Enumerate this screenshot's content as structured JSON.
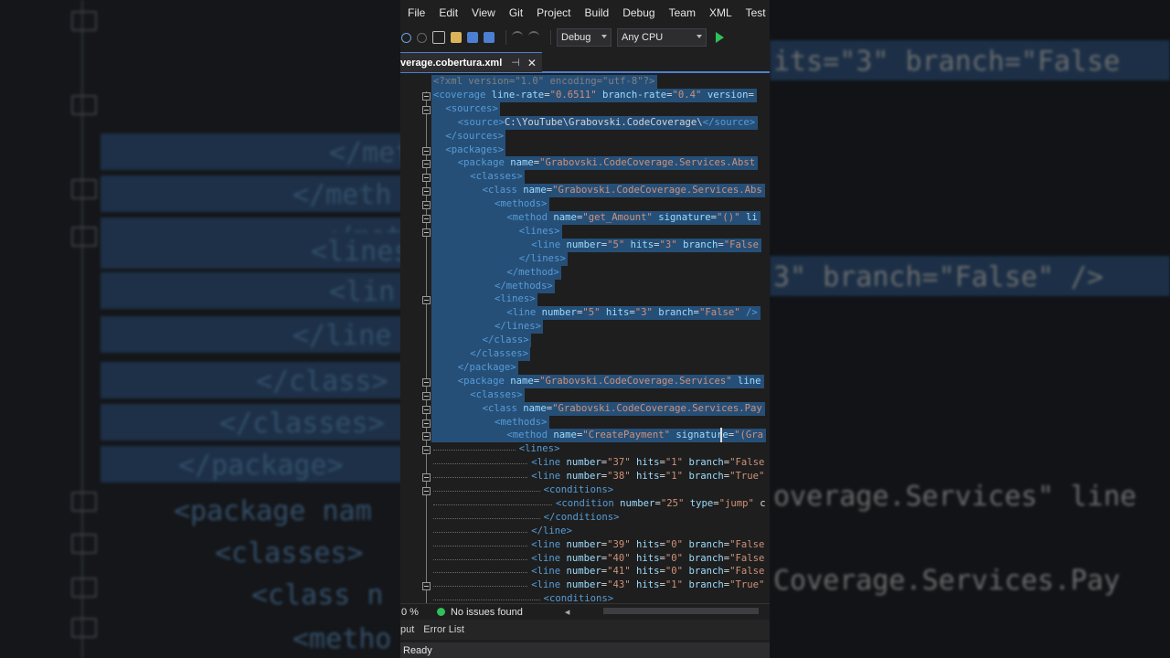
{
  "menu": [
    "File",
    "Edit",
    "View",
    "Git",
    "Project",
    "Build",
    "Debug",
    "Team",
    "XML",
    "Test"
  ],
  "toolbar": {
    "config": "Debug",
    "platform": "Any CPU"
  },
  "tab": {
    "label": "verage.cobertura.xml"
  },
  "code": [
    {
      "indent": 0,
      "tokens": [
        [
          "pi",
          "<?xml version=\"1.0\" encoding=\"utf-8\"?>"
        ]
      ]
    },
    {
      "indent": 0,
      "tokens": [
        [
          "t",
          "<coverage"
        ],
        [
          "an",
          " line-rate"
        ],
        [
          "txt",
          "="
        ],
        [
          "av",
          "\"0.6511\""
        ],
        [
          "an",
          " branch-rate"
        ],
        [
          "txt",
          "="
        ],
        [
          "av",
          "\"0.4\""
        ],
        [
          "an",
          " version"
        ],
        [
          "txt",
          "="
        ]
      ]
    },
    {
      "indent": 1,
      "tokens": [
        [
          "t",
          "<sources>"
        ]
      ]
    },
    {
      "indent": 2,
      "tokens": [
        [
          "t",
          "<source>"
        ],
        [
          "txt",
          "C:\\YouTube\\Grabovski.CodeCoverage\\"
        ],
        [
          "t",
          "</source>"
        ]
      ]
    },
    {
      "indent": 1,
      "tokens": [
        [
          "t",
          "</sources>"
        ]
      ]
    },
    {
      "indent": 1,
      "tokens": [
        [
          "t",
          "<packages>"
        ]
      ]
    },
    {
      "indent": 2,
      "tokens": [
        [
          "t",
          "<package"
        ],
        [
          "an",
          " name"
        ],
        [
          "txt",
          "="
        ],
        [
          "av",
          "\"Grabovski.CodeCoverage.Services.Abst"
        ]
      ]
    },
    {
      "indent": 3,
      "tokens": [
        [
          "t",
          "<classes>"
        ]
      ]
    },
    {
      "indent": 4,
      "tokens": [
        [
          "t",
          "<class"
        ],
        [
          "an",
          " name"
        ],
        [
          "txt",
          "="
        ],
        [
          "av",
          "\"Grabovski.CodeCoverage.Services.Abs"
        ]
      ]
    },
    {
      "indent": 5,
      "tokens": [
        [
          "t",
          "<methods>"
        ]
      ]
    },
    {
      "indent": 6,
      "tokens": [
        [
          "t",
          "<method"
        ],
        [
          "an",
          " name"
        ],
        [
          "txt",
          "="
        ],
        [
          "av",
          "\"get_Amount\""
        ],
        [
          "an",
          " signature"
        ],
        [
          "txt",
          "="
        ],
        [
          "av",
          "\"()\""
        ],
        [
          "an",
          " li"
        ]
      ]
    },
    {
      "indent": 7,
      "tokens": [
        [
          "t",
          "<lines>"
        ]
      ]
    },
    {
      "indent": 8,
      "tokens": [
        [
          "t",
          "<line"
        ],
        [
          "an",
          " number"
        ],
        [
          "txt",
          "="
        ],
        [
          "av",
          "\"5\""
        ],
        [
          "an",
          " hits"
        ],
        [
          "txt",
          "="
        ],
        [
          "av",
          "\"3\""
        ],
        [
          "an",
          " branch"
        ],
        [
          "txt",
          "="
        ],
        [
          "av",
          "\"False"
        ]
      ]
    },
    {
      "indent": 7,
      "tokens": [
        [
          "t",
          "</lines>"
        ]
      ]
    },
    {
      "indent": 6,
      "tokens": [
        [
          "t",
          "</method>"
        ]
      ]
    },
    {
      "indent": 5,
      "tokens": [
        [
          "t",
          "</methods>"
        ]
      ]
    },
    {
      "indent": 5,
      "tokens": [
        [
          "t",
          "<lines>"
        ]
      ]
    },
    {
      "indent": 6,
      "tokens": [
        [
          "t",
          "<line"
        ],
        [
          "an",
          " number"
        ],
        [
          "txt",
          "="
        ],
        [
          "av",
          "\"5\""
        ],
        [
          "an",
          " hits"
        ],
        [
          "txt",
          "="
        ],
        [
          "av",
          "\"3\""
        ],
        [
          "an",
          " branch"
        ],
        [
          "txt",
          "="
        ],
        [
          "av",
          "\"False\""
        ],
        [
          "t",
          " />"
        ]
      ]
    },
    {
      "indent": 5,
      "tokens": [
        [
          "t",
          "</lines>"
        ]
      ]
    },
    {
      "indent": 4,
      "tokens": [
        [
          "t",
          "</class>"
        ]
      ]
    },
    {
      "indent": 3,
      "tokens": [
        [
          "t",
          "</classes>"
        ]
      ]
    },
    {
      "indent": 2,
      "tokens": [
        [
          "t",
          "</package>"
        ]
      ]
    },
    {
      "indent": 2,
      "tokens": [
        [
          "t",
          "<package"
        ],
        [
          "an",
          " name"
        ],
        [
          "txt",
          "="
        ],
        [
          "av",
          "\"Grabovski.CodeCoverage.Services\""
        ],
        [
          "an",
          " line"
        ]
      ]
    },
    {
      "indent": 3,
      "tokens": [
        [
          "t",
          "<classes>"
        ]
      ]
    },
    {
      "indent": 4,
      "tokens": [
        [
          "t",
          "<class"
        ],
        [
          "an",
          " name"
        ],
        [
          "txt",
          "="
        ],
        [
          "av",
          "\"Grabovski.CodeCoverage.Services.Pay"
        ]
      ]
    },
    {
      "indent": 5,
      "tokens": [
        [
          "t",
          "<methods>"
        ]
      ]
    },
    {
      "indent": 6,
      "tokens": [
        [
          "t",
          "<method"
        ],
        [
          "an",
          " name"
        ],
        [
          "txt",
          "="
        ],
        [
          "av",
          "\"CreatePayment\""
        ],
        [
          "an",
          " signature"
        ],
        [
          "txt",
          "="
        ],
        [
          "av",
          "\"(Gra"
        ]
      ]
    },
    {
      "indent": 7,
      "tokens": [
        [
          "t",
          "<lines>"
        ]
      ]
    },
    {
      "indent": 8,
      "tokens": [
        [
          "t",
          "<line"
        ],
        [
          "an",
          " number"
        ],
        [
          "txt",
          "="
        ],
        [
          "av",
          "\"37\""
        ],
        [
          "an",
          " hits"
        ],
        [
          "txt",
          "="
        ],
        [
          "av",
          "\"1\""
        ],
        [
          "an",
          " branch"
        ],
        [
          "txt",
          "="
        ],
        [
          "av",
          "\"False"
        ]
      ]
    },
    {
      "indent": 8,
      "tokens": [
        [
          "t",
          "<line"
        ],
        [
          "an",
          " number"
        ],
        [
          "txt",
          "="
        ],
        [
          "av",
          "\"38\""
        ],
        [
          "an",
          " hits"
        ],
        [
          "txt",
          "="
        ],
        [
          "av",
          "\"1\""
        ],
        [
          "an",
          " branch"
        ],
        [
          "txt",
          "="
        ],
        [
          "av",
          "\"True\""
        ]
      ]
    },
    {
      "indent": 9,
      "tokens": [
        [
          "t",
          "<conditions>"
        ]
      ]
    },
    {
      "indent": 10,
      "tokens": [
        [
          "t",
          "<condition"
        ],
        [
          "an",
          " number"
        ],
        [
          "txt",
          "="
        ],
        [
          "av",
          "\"25\""
        ],
        [
          "an",
          " type"
        ],
        [
          "txt",
          "="
        ],
        [
          "av",
          "\"jump\""
        ],
        [
          "txt",
          " c"
        ]
      ]
    },
    {
      "indent": 9,
      "tokens": [
        [
          "t",
          "</conditions>"
        ]
      ]
    },
    {
      "indent": 8,
      "tokens": [
        [
          "t",
          "</line>"
        ]
      ]
    },
    {
      "indent": 8,
      "tokens": [
        [
          "t",
          "<line"
        ],
        [
          "an",
          " number"
        ],
        [
          "txt",
          "="
        ],
        [
          "av",
          "\"39\""
        ],
        [
          "an",
          " hits"
        ],
        [
          "txt",
          "="
        ],
        [
          "av",
          "\"0\""
        ],
        [
          "an",
          " branch"
        ],
        [
          "txt",
          "="
        ],
        [
          "av",
          "\"False"
        ]
      ]
    },
    {
      "indent": 8,
      "tokens": [
        [
          "t",
          "<line"
        ],
        [
          "an",
          " number"
        ],
        [
          "txt",
          "="
        ],
        [
          "av",
          "\"40\""
        ],
        [
          "an",
          " hits"
        ],
        [
          "txt",
          "="
        ],
        [
          "av",
          "\"0\""
        ],
        [
          "an",
          " branch"
        ],
        [
          "txt",
          "="
        ],
        [
          "av",
          "\"False"
        ]
      ]
    },
    {
      "indent": 8,
      "tokens": [
        [
          "t",
          "<line"
        ],
        [
          "an",
          " number"
        ],
        [
          "txt",
          "="
        ],
        [
          "av",
          "\"41\""
        ],
        [
          "an",
          " hits"
        ],
        [
          "txt",
          "="
        ],
        [
          "av",
          "\"0\""
        ],
        [
          "an",
          " branch"
        ],
        [
          "txt",
          "="
        ],
        [
          "av",
          "\"False"
        ]
      ]
    },
    {
      "indent": 8,
      "tokens": [
        [
          "t",
          "<line"
        ],
        [
          "an",
          " number"
        ],
        [
          "txt",
          "="
        ],
        [
          "av",
          "\"43\""
        ],
        [
          "an",
          " hits"
        ],
        [
          "txt",
          "="
        ],
        [
          "av",
          "\"1\""
        ],
        [
          "an",
          " branch"
        ],
        [
          "txt",
          "="
        ],
        [
          "av",
          "\"True\""
        ]
      ]
    },
    {
      "indent": 9,
      "tokens": [
        [
          "t",
          "<conditions>"
        ]
      ]
    }
  ],
  "selected_lines": 27,
  "status": {
    "zoom": "0 %",
    "issues": "No issues found",
    "state": "Ready"
  },
  "panel_tabs": [
    "put",
    "Error List"
  ],
  "bg_left": [
    "</meth",
    "</meth",
    "</method",
    "<lines>",
    "<lin",
    "</line",
    "</class>",
    "</classes>",
    "</package>",
    "<package nam",
    "<classes>",
    "<class n",
    "<metho"
  ],
  "bg_right": [
    "its=\"3\" branch=\"False",
    "3\" branch=\"False\" />",
    "overage.Services\" line",
    "Coverage.Services.Pay"
  ],
  "colors": {
    "selection": "#264f78",
    "tag": "#569cd6",
    "attr_name": "#9cdcfe",
    "attr_value": "#ce9178",
    "accent": "#4c7fd1",
    "ok": "#2fbf5b"
  }
}
